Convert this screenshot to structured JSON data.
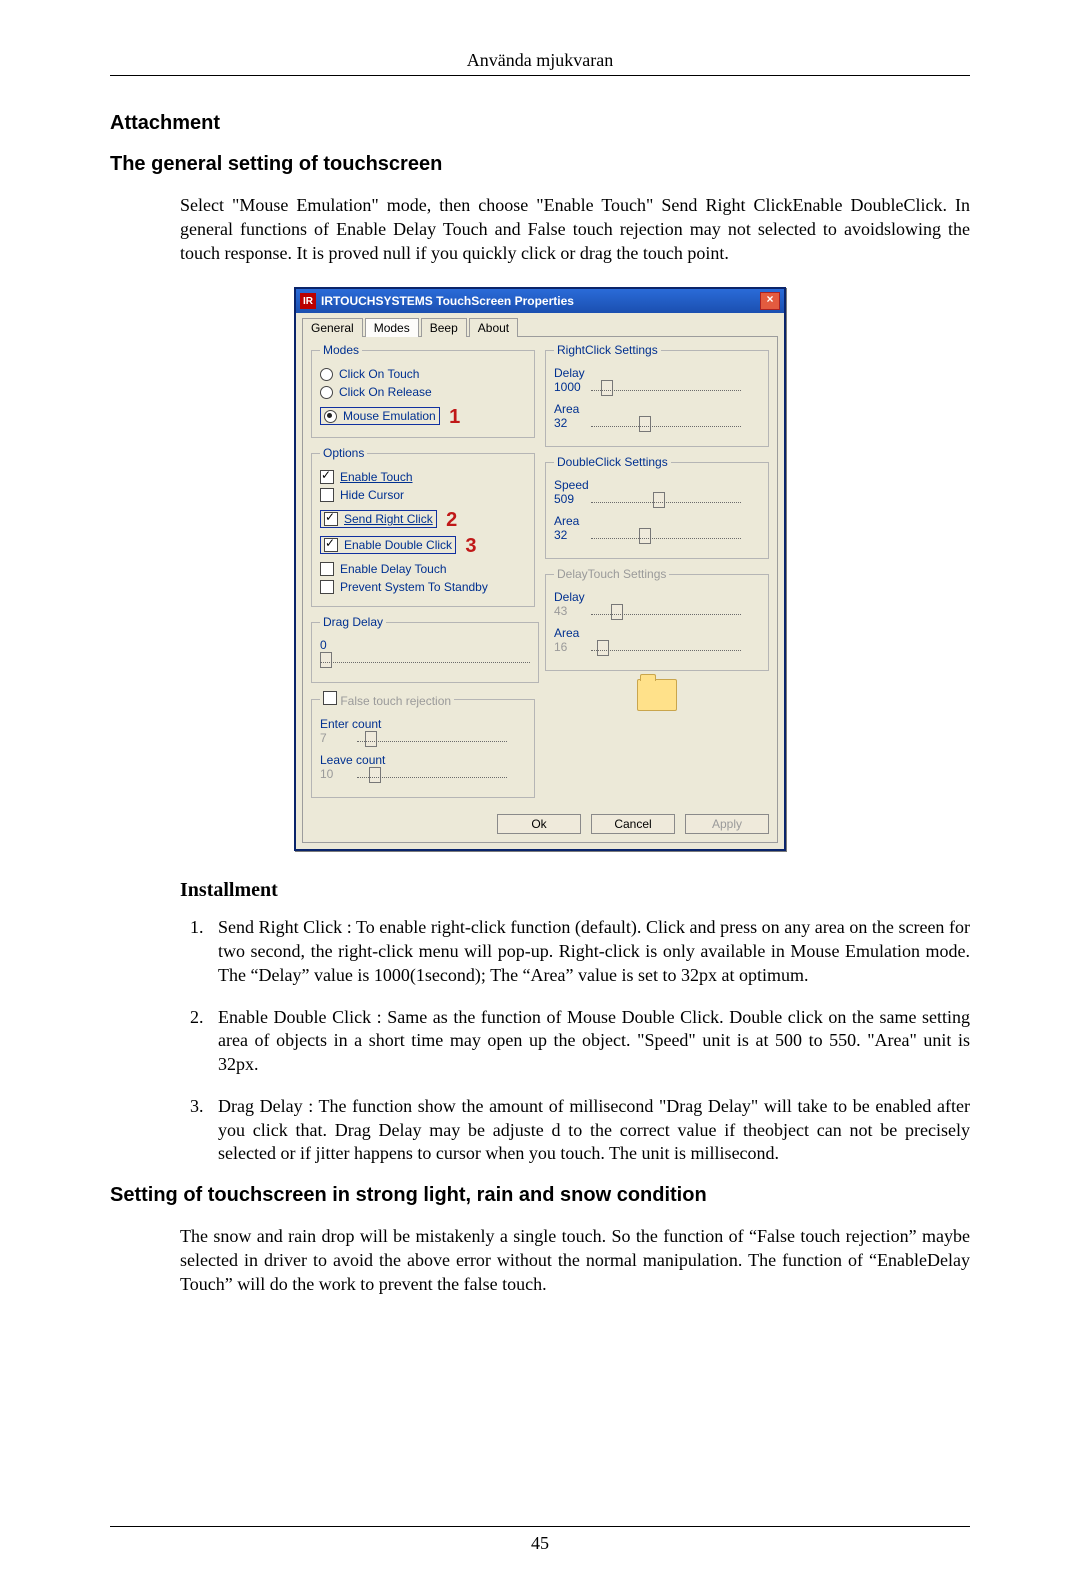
{
  "header": {
    "running": "Använda mjukvaran"
  },
  "h_attachment": "Attachment",
  "h_general": "The general setting of touchscreen",
  "p_general": "Select \"Mouse Emulation\" mode, then choose \"Enable Touch\" Send Right ClickEnable DoubleClick. In general functions of Enable Delay Touch and False touch rejection may not selected to avoidslowing the touch response. It is proved null if you quickly click or drag the touch point.",
  "dialog": {
    "title": "IRTOUCHSYSTEMS TouchScreen Properties",
    "tabs": [
      "General",
      "Modes",
      "Beep",
      "About"
    ],
    "active_tab": 1,
    "modes": {
      "legend": "Modes",
      "click_on_touch": "Click On Touch",
      "click_on_release": "Click On Release",
      "mouse_emulation": "Mouse Emulation",
      "annot1": "1"
    },
    "options": {
      "legend": "Options",
      "enable_touch": "Enable Touch",
      "hide_cursor": "Hide Cursor",
      "send_right_click": "Send Right Click",
      "annot2": "2",
      "enable_double_click": "Enable Double Click",
      "annot3": "3",
      "enable_delay_touch": "Enable Delay Touch",
      "prevent_standby": "Prevent System To Standby"
    },
    "drag_delay": {
      "legend": "Drag Delay",
      "value": "0"
    },
    "false_touch": {
      "legend_chk": "False touch rejection",
      "enter_label": "Enter count",
      "enter_value": "7",
      "leave_label": "Leave count",
      "leave_value": "10"
    },
    "rightclick": {
      "legend": "RightClick Settings",
      "delay_label": "Delay",
      "delay_value": "1000",
      "area_label": "Area",
      "area_value": "32"
    },
    "doubleclick": {
      "legend": "DoubleClick Settings",
      "speed_label": "Speed",
      "speed_value": "509",
      "area_label": "Area",
      "area_value": "32"
    },
    "delaytouch": {
      "legend": "DelayTouch Settings",
      "delay_label": "Delay",
      "delay_value": "43",
      "area_label": "Area",
      "area_value": "16"
    },
    "buttons": {
      "ok": "Ok",
      "cancel": "Cancel",
      "apply": "Apply"
    }
  },
  "h_install": "Installment",
  "inst": {
    "i1": "Send Right Click : To enable right-click function (default). Click and press on any area on the screen for two second, the right-click menu will pop-up. Right-click is only available in Mouse Emulation mode. The “Delay” value is 1000(1second); The “Area” value is set to 32px at optimum.",
    "i2": "Enable Double Click : Same as the function of Mouse Double Click. Double click on the same setting area of objects in a short time may open up the object. \"Speed\" unit is at 500 to 550. \"Area\" unit is 32px.",
    "i3": "Drag Delay : The function show the amount of millisecond \"Drag Delay\" will take to be enabled after you click that. Drag Delay may be adjuste d to the correct value if theobject can not be precisely selected or if jitter happens to cursor when you touch. The unit is millisecond."
  },
  "h_strong": "Setting of touchscreen in strong light, rain and snow condition",
  "p_strong": "The snow and rain drop will be mistakenly a single touch. So the function of “False touch rejection” maybe selected in driver to avoid the above error without the normal manipulation. The function of “EnableDelay Touch” will do the work to prevent the false touch.",
  "page_number": "45"
}
